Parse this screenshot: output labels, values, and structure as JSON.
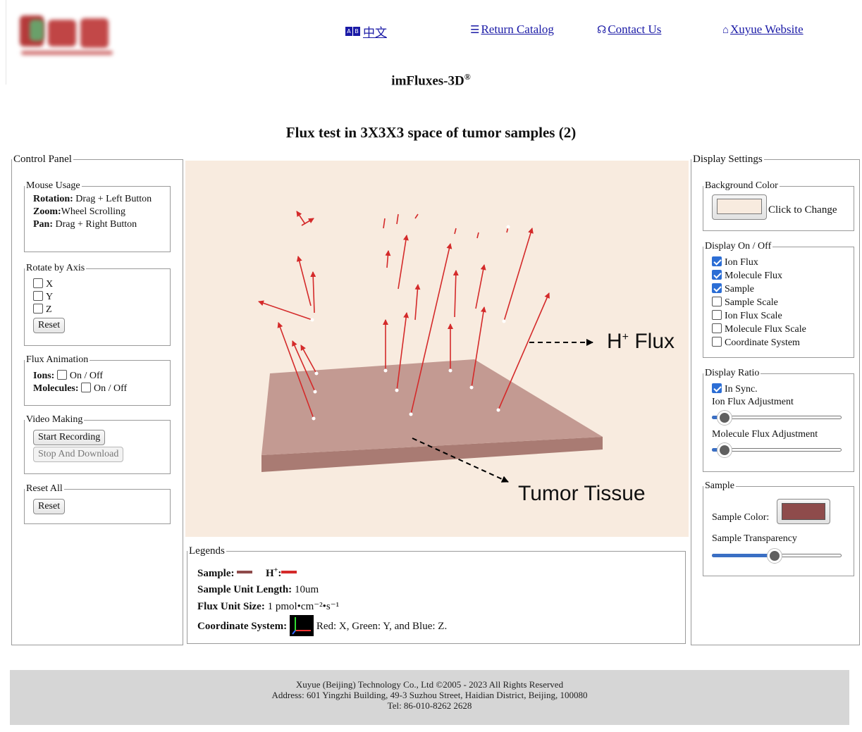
{
  "header": {
    "lang_label": "中文",
    "lang_icon_chars": [
      "A",
      "B"
    ],
    "nav": [
      {
        "label": "Return Catalog",
        "icon": "list-icon"
      },
      {
        "label": "Contact Us",
        "icon": "headset-icon"
      },
      {
        "label": "Xuyue Website",
        "icon": "home-icon"
      }
    ]
  },
  "app_title": "imFluxes-3D",
  "app_title_mark": "®",
  "page_title": "Flux test in 3X3X3 space of tumor samples (2)",
  "control_panel": {
    "title": "Control Panel",
    "mouse_usage": {
      "title": "Mouse Usage",
      "rows": [
        {
          "key": "Rotation:",
          "value": " Drag + Left Button"
        },
        {
          "key": "Zoom:",
          "value": "Wheel Scrolling"
        },
        {
          "key": "Pan:",
          "value": " Drag + Right Button"
        }
      ]
    },
    "rotate": {
      "title": "Rotate by Axis",
      "axes": [
        "X",
        "Y",
        "Z"
      ],
      "reset_label": "Reset"
    },
    "animation": {
      "title": "Flux Animation",
      "ions_label": "Ions:",
      "molecules_label": "Molecules:",
      "toggle_label": "On / Off"
    },
    "video": {
      "title": "Video Making",
      "start_label": "Start Recording",
      "stop_label": "Stop And Download"
    },
    "reset_all": {
      "title": "Reset All",
      "reset_label": "Reset"
    }
  },
  "viewer": {
    "flux_label": "Flux",
    "flux_sup": "+",
    "flux_ion": "H",
    "tissue_label": "Tumor Tissue",
    "background_color": "#f8ebdf",
    "sample_color": "#c39a92",
    "arrow_color": "#d42a2a"
  },
  "legends": {
    "title": "Legends",
    "sample_label": "Sample:",
    "ion_label": "H",
    "ion_sup": "+",
    "ion_colon": ":",
    "unit_length_key": "Sample Unit Length:",
    "unit_length_value": " 10um",
    "flux_size_key": "Flux Unit Size:",
    "flux_size_value": " 1 pmol•cm⁻²•s⁻¹",
    "coord_key": "Coordinate System:",
    "coord_value": "Red: X, Green: Y, and Blue: Z."
  },
  "display_settings": {
    "title": "Display Settings",
    "background": {
      "title": "Background Color",
      "button_label": "Click to Change",
      "value": "#f8ebdf"
    },
    "on_off": {
      "title": "Display On / Off",
      "items": [
        {
          "label": "Ion Flux",
          "checked": true
        },
        {
          "label": "Molecule Flux",
          "checked": true
        },
        {
          "label": "Sample",
          "checked": true
        },
        {
          "label": "Sample Scale",
          "checked": false
        },
        {
          "label": "Ion Flux Scale",
          "checked": false
        },
        {
          "label": "Molecule Flux Scale",
          "checked": false
        },
        {
          "label": "Coordinate System",
          "checked": false
        }
      ]
    },
    "ratio": {
      "title": "Display Ratio",
      "sync_label": "In Sync.",
      "sync_checked": true,
      "ion_adj_label": "Ion Flux Adjustment",
      "ion_adj_value": 0.05,
      "mol_adj_label": "Molecule Flux Adjustment",
      "mol_adj_value": 0.05
    },
    "sample": {
      "title": "Sample",
      "color_label": "Sample Color:",
      "color_value": "#8e4b4b",
      "transparency_label": "Sample Transparency",
      "transparency_value": 0.48
    }
  },
  "footer": {
    "line1": "Xuyue (Beijing) Technology Co., Ltd ©2005 - 2023 All Rights Reserved",
    "line2": "Address: 601 Yingzhi Building, 49-3 Suzhou Street, Haidian District, Beijing, 100080",
    "line3": "Tel: 86-010-8262 2628"
  }
}
